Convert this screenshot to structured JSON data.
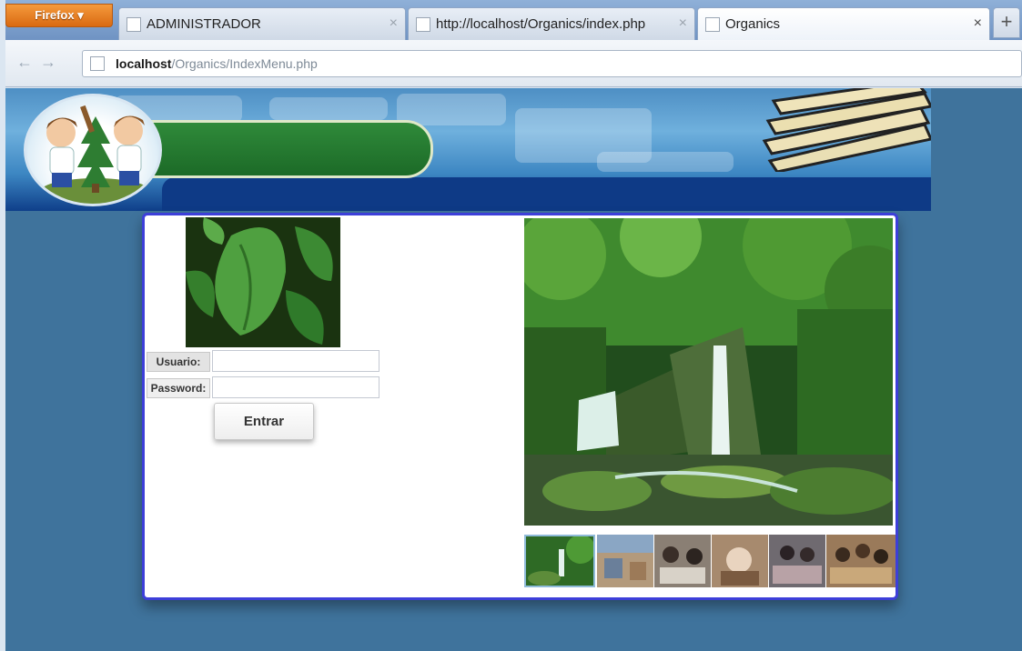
{
  "browser": {
    "menu_button": "Firefox",
    "tabs": [
      {
        "title": "ADMINISTRADOR",
        "active": false
      },
      {
        "title": "http://localhost/Organics/index.php",
        "active": false
      },
      {
        "title": "Organics",
        "active": true
      }
    ],
    "close_glyph": "×",
    "new_tab_glyph": "+",
    "back_glyph": "←",
    "forward_glyph": "→",
    "url_host": "localhost",
    "url_path": "/Organics/IndexMenu.php"
  },
  "login": {
    "user_label": "Usuario:",
    "password_label": "Password:",
    "user_value": "",
    "password_value": "",
    "submit_label": "Entrar"
  },
  "gallery": {
    "thumbnail_count": 6,
    "selected_thumbnail": 1
  },
  "colors": {
    "page_background": "#3f739c",
    "content_border": "#3d3fd9",
    "banner_green": "#1c6a27",
    "banner_navy": "#0e3a86"
  }
}
